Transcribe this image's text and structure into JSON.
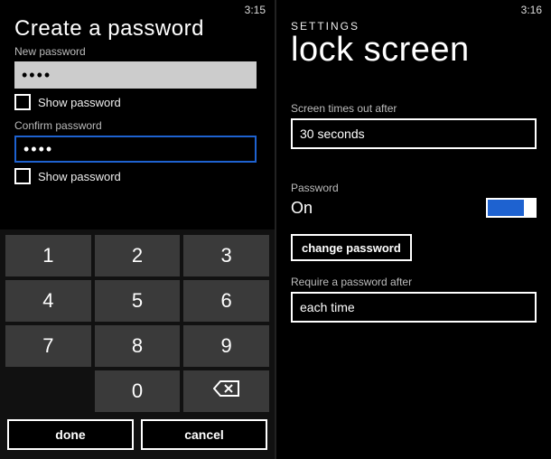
{
  "left": {
    "status_time": "3:15",
    "title": "Create a password",
    "new_password_label": "New password",
    "new_password_value": "••••",
    "show_password_1": "Show password",
    "confirm_password_label": "Confirm password",
    "confirm_password_value": "••••",
    "show_password_2": "Show password",
    "keys": [
      "1",
      "2",
      "3",
      "4",
      "5",
      "6",
      "7",
      "8",
      "9",
      "",
      "0",
      ""
    ],
    "done": "done",
    "cancel": "cancel"
  },
  "right": {
    "status_time": "3:16",
    "breadcrumb": "SETTINGS",
    "page_title": "lock screen",
    "timeout_label": "Screen times out after",
    "timeout_value": "30 seconds",
    "password_label": "Password",
    "password_state": "On",
    "change_password": "change password",
    "require_label": "Require a password after",
    "require_value": "each time"
  }
}
